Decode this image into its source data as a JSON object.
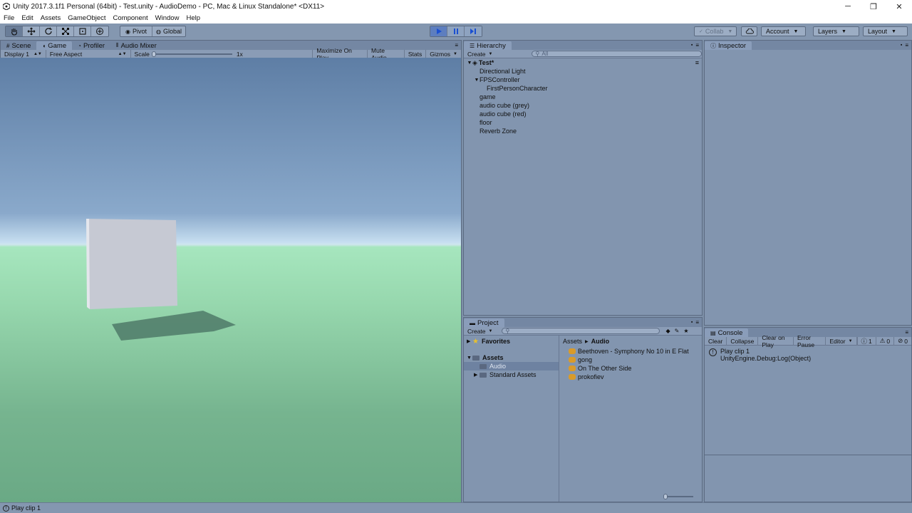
{
  "window": {
    "title": "Unity 2017.3.1f1 Personal (64bit) - Test.unity - AudioDemo - PC, Mac & Linux Standalone* <DX11>",
    "controls": {
      "minimize": "─",
      "restore": "❐",
      "close": "✕"
    }
  },
  "menu": [
    "File",
    "Edit",
    "Assets",
    "GameObject",
    "Component",
    "Window",
    "Help"
  ],
  "toolbar": {
    "pivot_label": "Pivot",
    "global_label": "Global",
    "collab_label": "Collab",
    "account_label": "Account",
    "layers_label": "Layers",
    "layout_label": "Layout",
    "play_active": true
  },
  "scene_panel": {
    "tabs": [
      "Scene",
      "Game",
      "Profiler",
      "Audio Mixer"
    ],
    "active_tab": "Game",
    "display": "Display 1",
    "aspect": "Free Aspect",
    "scale_label": "Scale",
    "scale_value": "1x",
    "maximize": "Maximize On Play",
    "mute": "Mute Audio",
    "stats": "Stats",
    "gizmos": "Gizmos"
  },
  "hierarchy": {
    "tab": "Hierarchy",
    "create": "Create",
    "search_placeholder": "All",
    "root": "Test*",
    "items": [
      {
        "label": "Directional Light"
      },
      {
        "label": "FPSController"
      },
      {
        "label": "FirstPersonCharacter"
      },
      {
        "label": "game"
      },
      {
        "label": "audio cube (grey)"
      },
      {
        "label": "audio cube (red)"
      },
      {
        "label": "floor"
      },
      {
        "label": "Reverb Zone"
      }
    ]
  },
  "inspector": {
    "tab": "Inspector"
  },
  "project": {
    "tab": "Project",
    "create": "Create",
    "favorites": "Favorites",
    "assets": "Assets",
    "audio_folder": "Audio",
    "standard_assets": "Standard Assets",
    "breadcrumb_root": "Assets",
    "breadcrumb_leaf": "Audio",
    "files": [
      {
        "label": "Beethoven - Symphony No 10 in E Flat"
      },
      {
        "label": "gong"
      },
      {
        "label": "On The Other Side"
      },
      {
        "label": "prokofiev"
      }
    ]
  },
  "console": {
    "tab": "Console",
    "buttons": [
      "Clear",
      "Collapse",
      "Clear on Play",
      "Error Pause"
    ],
    "editor": "Editor",
    "info_count": "1",
    "warn_count": "0",
    "error_count": "0",
    "log_line1": "Play clip 1",
    "log_line2": "UnityEngine.Debug:Log(Object)"
  },
  "status": {
    "message": "Play clip 1"
  }
}
